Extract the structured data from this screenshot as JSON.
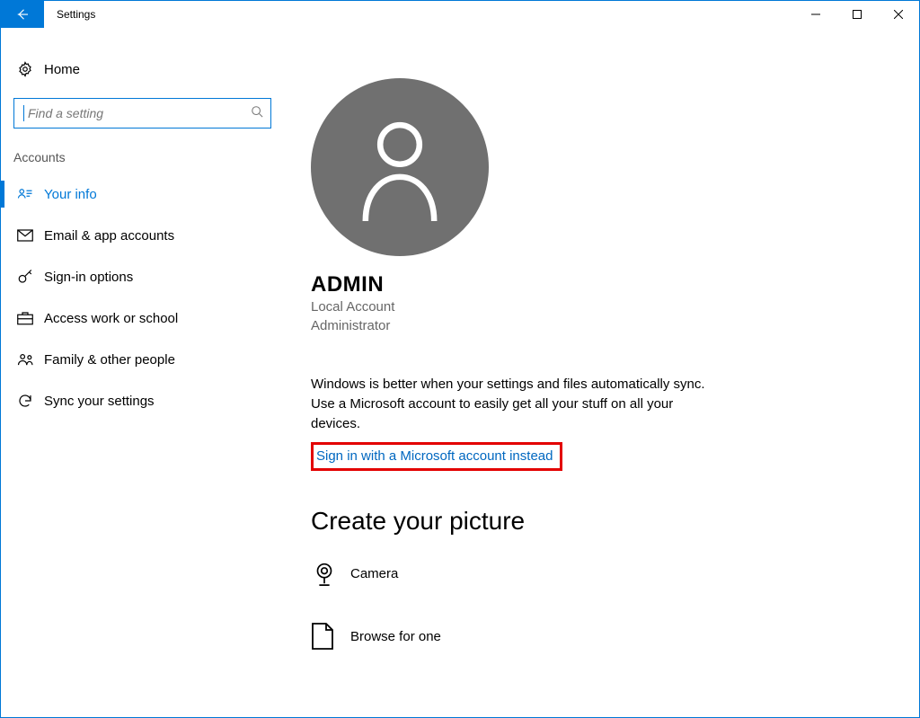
{
  "window": {
    "title": "Settings"
  },
  "sidebar": {
    "home_label": "Home",
    "search_placeholder": "Find a setting",
    "section_title": "Accounts",
    "items": [
      {
        "label": "Your info",
        "active": true
      },
      {
        "label": "Email & app accounts",
        "active": false
      },
      {
        "label": "Sign-in options",
        "active": false
      },
      {
        "label": "Access work or school",
        "active": false
      },
      {
        "label": "Family & other people",
        "active": false
      },
      {
        "label": "Sync your settings",
        "active": false
      }
    ]
  },
  "profile": {
    "username": "ADMIN",
    "account_type": "Local Account",
    "role": "Administrator"
  },
  "sync_paragraph": "Windows is better when your settings and files automatically sync. Use a Microsoft account to easily get all your stuff on all your devices.",
  "sign_in_link": "Sign in with a Microsoft account instead",
  "picture_section": {
    "heading": "Create your picture",
    "camera_label": "Camera",
    "browse_label": "Browse for one"
  }
}
